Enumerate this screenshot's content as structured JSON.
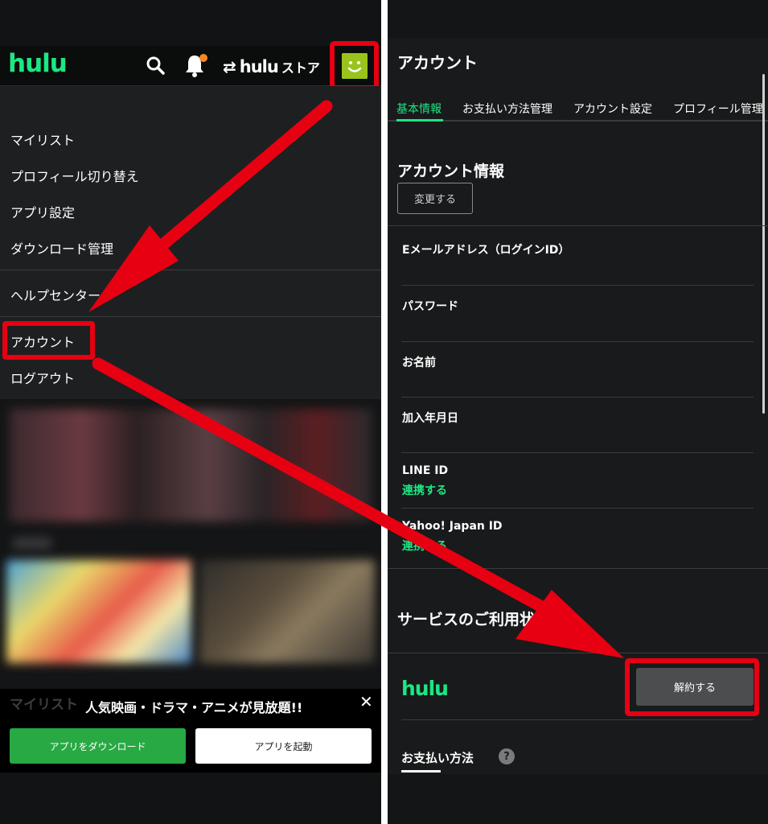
{
  "colors": {
    "hulu_green": "#1ce783",
    "highlight_red": "#e60012",
    "download_button": "#28a943",
    "notification_dot": "#f5881f",
    "avatar": "#9ac31c"
  },
  "left": {
    "header": {
      "logo": "hulu",
      "search_icon": "search-icon",
      "bell_icon": "bell-icon",
      "store_swap_icon": "⇄",
      "store_logo": "hulu",
      "store_label": "ストア",
      "avatar_icon": "smiley-avatar-icon"
    },
    "menu": {
      "items": [
        "マイリスト",
        "プロフィール切り替え",
        "アプリ設定",
        "ダウンロード管理"
      ],
      "help_center": "ヘルプセンター",
      "account": "アカウント",
      "logout": "ログアウト"
    },
    "promo": {
      "underlying_text": "マイリスト",
      "text": "人気映画・ドラマ・アニメが見放題!!",
      "close": "✕",
      "download_button": "アプリをダウンロード",
      "launch_button": "アプリを起動"
    }
  },
  "right": {
    "title": "アカウント",
    "tabs": [
      "基本情報",
      "お支払い方法管理",
      "アカウント設定",
      "プロフィール管理"
    ],
    "active_tab": "基本情報",
    "account_info": {
      "title": "アカウント情報",
      "change_button": "変更する",
      "fields": [
        "Eメールアドレス（ログインID）",
        "パスワード",
        "お名前",
        "加入年月日",
        "LINE ID",
        "Yahoo! Japan ID"
      ],
      "line_link": "連携する",
      "yahoo_link": "連携する"
    },
    "service": {
      "title": "サービスのご利用状況",
      "logo": "hulu",
      "cancel_button": "解約する",
      "payment_title": "お支払い方法",
      "help_icon": "?"
    }
  }
}
